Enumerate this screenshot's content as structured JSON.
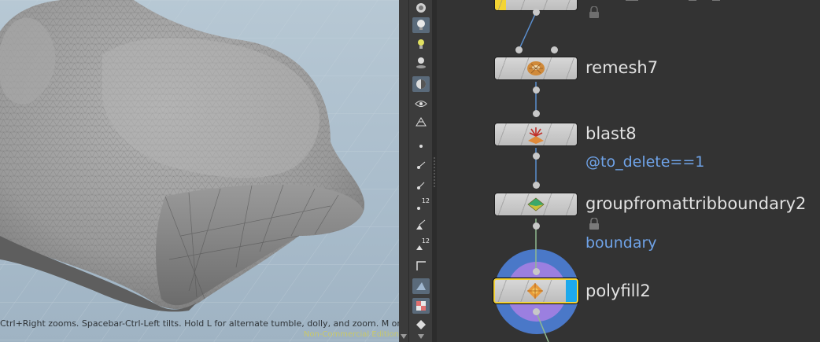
{
  "viewport": {
    "hint_text": "Ctrl+Right zooms. Spacebar-Ctrl-Left tilts. Hold L for alternate tumble, dolly, and zoom.    M or Alt+M for",
    "edition_text": "Non-Commercial Edition"
  },
  "toolbar": {
    "items": [
      {
        "name": "display-options-icon"
      },
      {
        "name": "light-icon",
        "active": true
      },
      {
        "name": "headlight-icon"
      },
      {
        "name": "camera-light-icon"
      },
      {
        "name": "shading-mode-icon",
        "active": true
      },
      {
        "name": "visibility-icon"
      },
      {
        "name": "wireframe-icon"
      },
      {
        "name": "point-display-icon"
      },
      {
        "name": "point-normals-icon"
      },
      {
        "name": "point-numbers-icon",
        "number": "12"
      },
      {
        "name": "primitive-normals-icon"
      },
      {
        "name": "primitive-numbers-icon",
        "number": "12"
      },
      {
        "name": "edges-icon"
      },
      {
        "name": "backface-icon",
        "active": true
      },
      {
        "name": "texture-icon",
        "active": true
      },
      {
        "name": "snapping-icon"
      }
    ]
  },
  "network": {
    "nodes": [
      {
        "id": "top",
        "label": "",
        "flag": "display-yellow"
      },
      {
        "id": "remesh7",
        "label": "remesh7",
        "icon": "remesh-icon"
      },
      {
        "id": "blast8",
        "label": "blast8",
        "icon": "blast-icon",
        "comment": "@to_delete==1"
      },
      {
        "id": "groupfromattribboundary2",
        "label": "groupfromattribboundary2",
        "icon": "group-icon",
        "comment": "boundary",
        "locked": true
      },
      {
        "id": "polyfill2",
        "label": "polyfill2",
        "icon": "polyfill-icon",
        "flag": "display-blue",
        "selected": true
      }
    ],
    "colors": {
      "wire_blue": "#5b8fcf",
      "wire_green": "#8fb98f",
      "comment_blue": "#6fa3e8",
      "selection_yellow": "#f2d23a",
      "display_blue": "#1da9ec",
      "ring_blue": "#4a78c8",
      "ring_purple": "#9b7fe0"
    }
  }
}
